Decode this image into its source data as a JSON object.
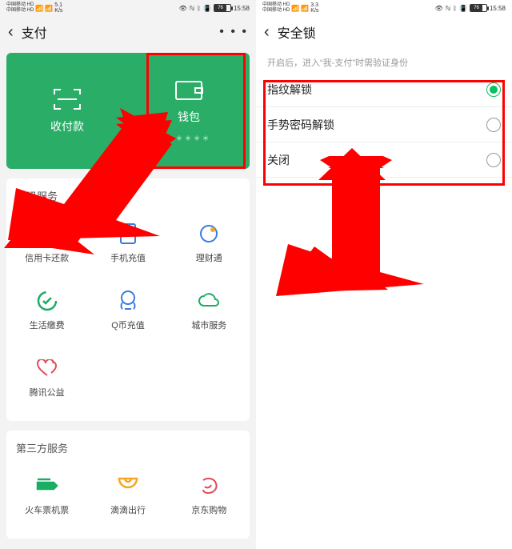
{
  "left": {
    "statusbar": {
      "carrier1": "中国移动 HD",
      "carrier2": "中国移动 HD",
      "signal": "46ᴳ ⁴⁶ᴳ",
      "speed": "5.1\nK/s",
      "icons": "⟳ ℕ ⁂ ⊪",
      "battery": "76",
      "time": "15:58"
    },
    "nav": {
      "title": "支付",
      "more": "• • •"
    },
    "green": {
      "pay_label": "收付款",
      "wallet_label": "钱包",
      "wallet_sub": "＊＊＊＊＊"
    },
    "tencent": {
      "title": "腾讯服务",
      "items": [
        {
          "label": "信用卡还款"
        },
        {
          "label": "手机充值"
        },
        {
          "label": "理财通"
        },
        {
          "label": "生活缴费"
        },
        {
          "label": "Q币充值"
        },
        {
          "label": "城市服务"
        },
        {
          "label": "腾讯公益"
        }
      ]
    },
    "third": {
      "title": "第三方服务",
      "items": [
        {
          "label": "火车票机票"
        },
        {
          "label": "滴滴出行"
        },
        {
          "label": "京东购物"
        }
      ]
    }
  },
  "right": {
    "statusbar": {
      "carrier1": "中国移动 HD",
      "carrier2": "中国移动 HD",
      "signal": "46ᴳ ⁴⁶ᴳ",
      "speed": "3.3\nK/s",
      "icons": "⟳ ℕ ⁂ ⊪",
      "battery": "76",
      "time": "15:58"
    },
    "nav": {
      "title": "安全锁"
    },
    "hint": "开启后，进入“我-支付”时需验证身份",
    "options": [
      {
        "label": "指纹解锁",
        "on": true
      },
      {
        "label": "手势密码解锁",
        "on": false
      },
      {
        "label": "关闭",
        "on": false
      }
    ]
  }
}
